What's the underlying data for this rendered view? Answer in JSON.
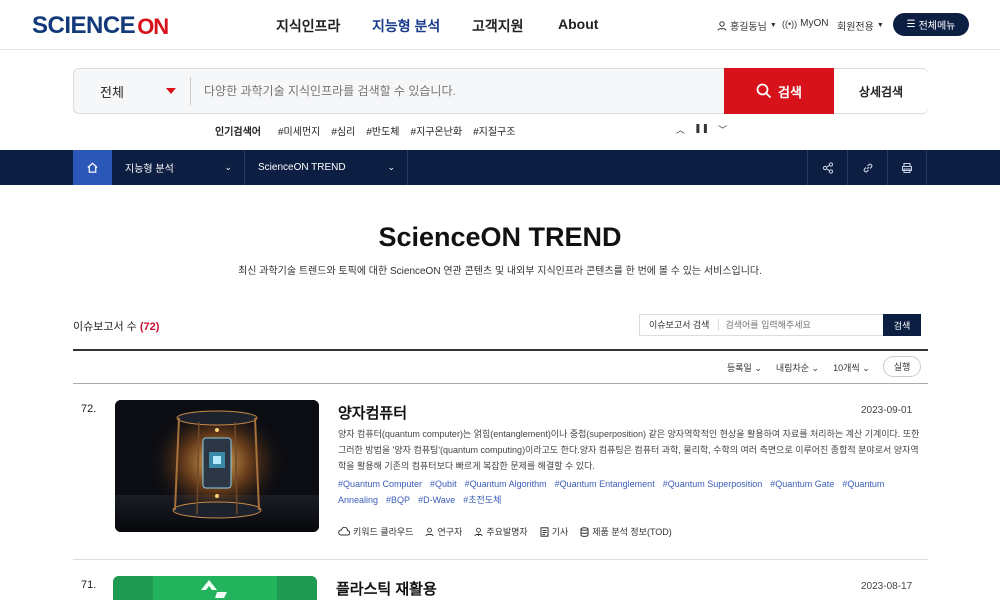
{
  "header": {
    "logo_text": "SCIENCE",
    "logo_on": "ON",
    "nav": [
      "지식인프라",
      "지능형 분석",
      "고객지원",
      "About"
    ],
    "user": "홍길동님",
    "myon": "MyON",
    "member_only": "회원전용",
    "all_menu": "전체메뉴"
  },
  "search": {
    "scope": "전체",
    "placeholder": "다양한 과학기술 지식인프라를 검색할 수 있습니다.",
    "button": "검색",
    "advanced": "상세검색",
    "popular_label": "인기검색어",
    "popular": [
      "#미세먼지",
      "#심리",
      "#반도체",
      "#지구온난화",
      "#지질구조"
    ]
  },
  "location": {
    "level1": "지능형 분석",
    "level2": "ScienceON TREND"
  },
  "main": {
    "title": "ScienceON TREND",
    "description": "최신 과학기술 트렌드와 토픽에 대한 ScienceON 연관 콘텐츠 및 내외부 지식인프라 콘텐츠를 한 번에 볼 수 있는 서비스입니다.",
    "count_label": "이슈보고서 수",
    "count_value": "(72)",
    "issue_search_label": "이슈보고서 검색",
    "issue_search_placeholder": "검색어를 입력해주세요",
    "issue_search_button": "검색",
    "sort": [
      "등록일",
      "내림차순",
      "10개씩"
    ],
    "run_button": "실행"
  },
  "reports": [
    {
      "num": "72.",
      "title": "양자컴퓨터",
      "date": "2023-09-01",
      "desc": "양자 컴퓨터(quantum computer)는 얽힘(entanglement)이나 중첩(superposition) 같은 양자역학적인 현상을 활용하여 자료를 처리하는 계산 기계이다. 또한 그러한 방법을 '양자 컴퓨팅'(quantum computing)이라고도 한다.양자 컴퓨팅은 컴퓨터 과학, 물리학, 수학의 여러 측면으로 이루어진 종합적 분야로서 양자역학을 활용해 기존의 컴퓨터보다 빠르게 복잡한 문제를 해결할 수 있다.",
      "tags": [
        "#Quantum Computer",
        "#Qubit",
        "#Quantum Algorithm",
        "#Quantum Entanglement",
        "#Quantum Superposition",
        "#Quantum Gate",
        "#Quantum Annealing",
        "#BQP",
        "#D-Wave",
        "#초전도체"
      ],
      "meta": [
        "키워드 클라우드",
        "연구자",
        "주요발명자",
        "기사",
        "제품 분석 정보(TOD)"
      ]
    },
    {
      "num": "71.",
      "title": "플라스틱 재활용",
      "date": "2023-08-17"
    }
  ],
  "colors": {
    "brand_red": "#d7121b",
    "navy": "#0d1e43",
    "home_blue": "#2b57b8",
    "tag_blue": "#3a5db8"
  }
}
